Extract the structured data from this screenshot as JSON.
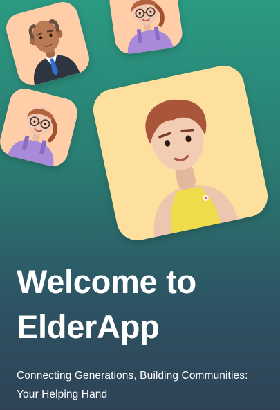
{
  "welcome": {
    "title": "Welcome to ElderApp",
    "subtitle": "Connecting Generations, Building Communities: Your Helping Hand"
  },
  "avatars": [
    {
      "icon": "elderly-man-avatar-icon"
    },
    {
      "icon": "girl-with-glasses-avatar-icon"
    },
    {
      "icon": "girl-with-glasses-avatar-icon"
    },
    {
      "icon": "young-man-avatar-icon"
    }
  ],
  "colors": {
    "background_top": "#2b9a82",
    "background_bottom": "#2f4256",
    "tile_peach": "#ffcda8",
    "tile_yellow": "#fde09e",
    "text": "#ffffff"
  }
}
